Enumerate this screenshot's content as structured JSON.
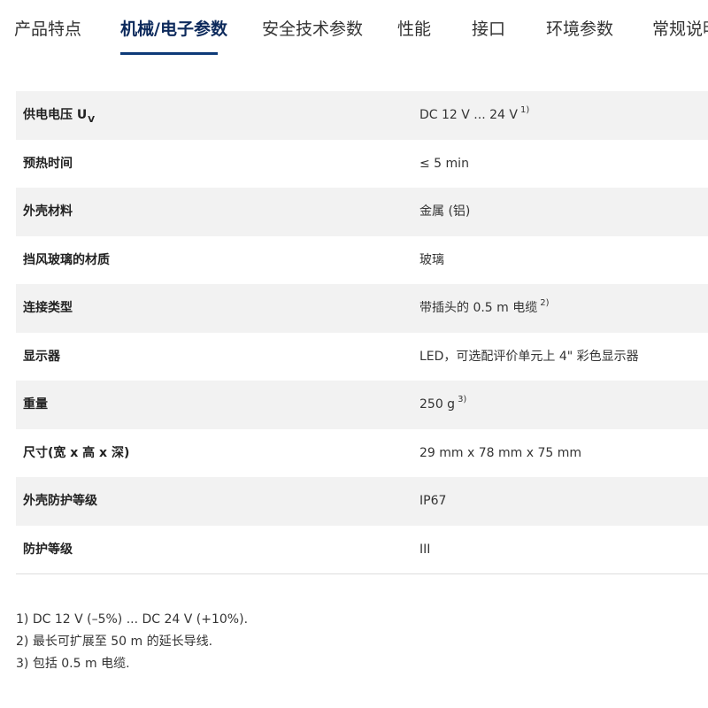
{
  "tabs": [
    {
      "label": "产品特点",
      "active": false
    },
    {
      "label": "机械/电子参数",
      "active": true
    },
    {
      "label": "安全技术参数",
      "active": false
    },
    {
      "label": "性能",
      "active": false
    },
    {
      "label": "接口",
      "active": false
    },
    {
      "label": "环境参数",
      "active": false
    },
    {
      "label": "常规说明",
      "active": false
    }
  ],
  "specs": [
    {
      "label": "供电电压 U",
      "label_sub": "V",
      "value": "DC 12 V ... 24 V",
      "note": "1)"
    },
    {
      "label": "预热时间",
      "value": "≤ 5 min"
    },
    {
      "label": "外壳材料",
      "value": "金属 (铝)"
    },
    {
      "label": "挡风玻璃的材质",
      "value": "玻璃"
    },
    {
      "label": "连接类型",
      "value": "带插头的 0.5 m 电缆",
      "note": "2)"
    },
    {
      "label": "显示器",
      "value": "LED，可选配评价单元上 4\" 彩色显示器"
    },
    {
      "label": "重量",
      "value": "250 g",
      "note": "3)"
    },
    {
      "label": "尺寸(宽 x 高 x 深)",
      "value": "29 mm x 78 mm x 75 mm"
    },
    {
      "label": "外壳防护等级",
      "value": "IP67"
    },
    {
      "label": "防护等级",
      "value": "III"
    }
  ],
  "footnotes": [
    "1) DC 12 V (–5%) ... DC 24 V (+10%).",
    "2) 最长可扩展至 50 m 的延长导线.",
    "3) 包括 0.5 m 电缆."
  ],
  "colors": {
    "accent": "#0d3a78",
    "row_shade": "#f2f2f2"
  }
}
